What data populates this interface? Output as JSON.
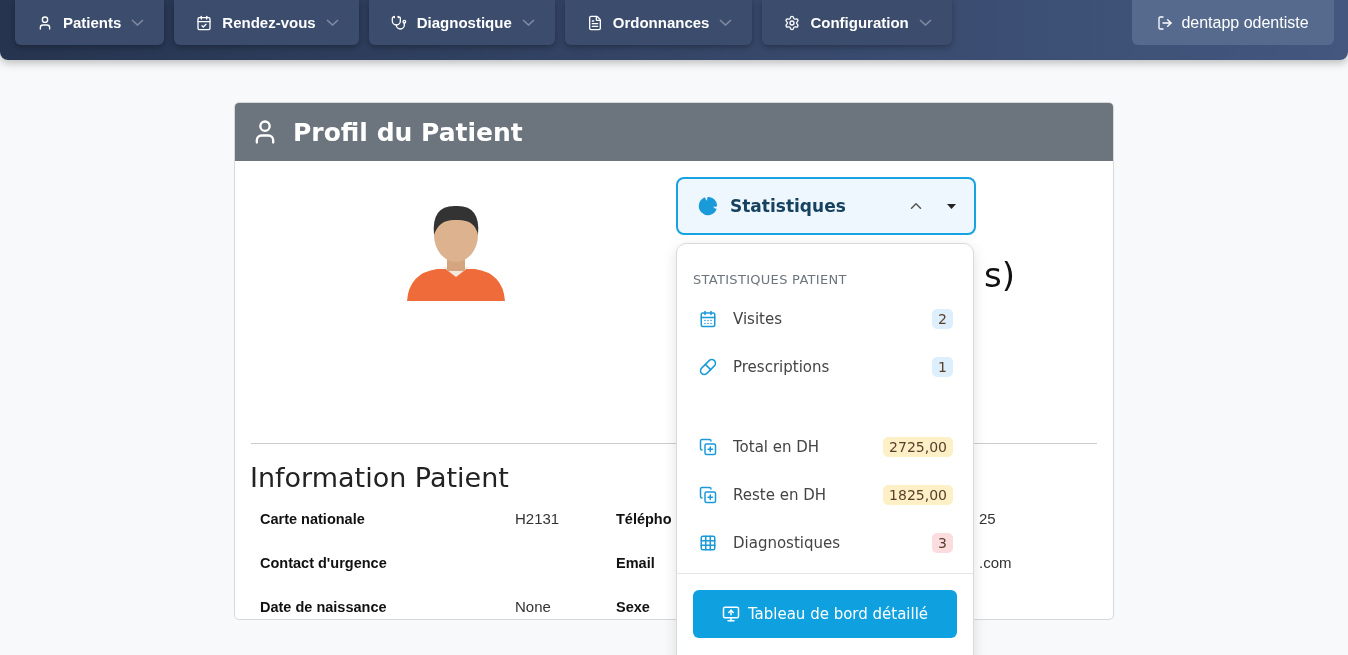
{
  "nav": {
    "items": [
      {
        "label": "Patients"
      },
      {
        "label": "Rendez-vous"
      },
      {
        "label": "Diagnostique"
      },
      {
        "label": "Ordonnances"
      },
      {
        "label": "Configuration"
      }
    ],
    "logout": "dentapp odentiste"
  },
  "card": {
    "title": "Profil du Patient",
    "name_visible": "s)"
  },
  "stats": {
    "label": "Statistiques",
    "expanded": true,
    "header": "STATISTIQUES PATIENT",
    "items": [
      {
        "label": "Visites",
        "value": "2",
        "color": "#ddeffc"
      },
      {
        "label": "Prescriptions",
        "value": "1",
        "color": "#ddeffc"
      },
      {
        "label": "Total en DH",
        "value": "2725,00",
        "color": "#fdf0c6"
      },
      {
        "label": "Reste en DH",
        "value": "1825,00",
        "color": "#fdf0c6"
      },
      {
        "label": "Diagnostiques",
        "value": "3",
        "color": "#fbdde0"
      }
    ],
    "button": "Tableau de bord détaillé"
  },
  "info": {
    "title": "Information Patient",
    "rows": [
      {
        "label": "Carte nationale",
        "value": "H2131",
        "label_2": "Télépho",
        "value_2": "25"
      },
      {
        "label": "Contact d'urgence",
        "label_2": "Email",
        "value_2": ".com"
      },
      {
        "label": "Date de naissance",
        "value": "None",
        "label_2": "Sexe"
      }
    ]
  }
}
